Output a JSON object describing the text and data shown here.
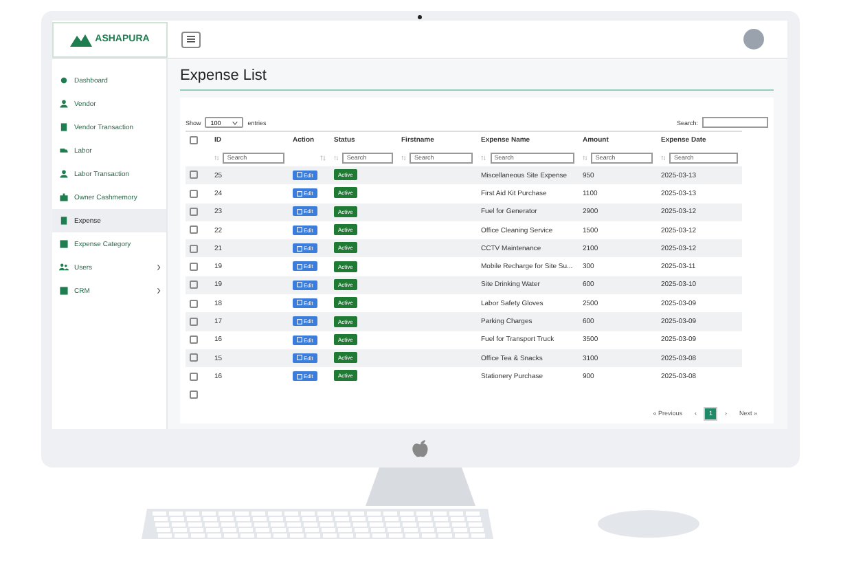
{
  "logo": {
    "text": "ASHAPURA"
  },
  "sidebar": {
    "items": [
      {
        "label": "Dashboard",
        "selected": false,
        "expandable": false
      },
      {
        "label": "Vendor",
        "selected": false,
        "expandable": false
      },
      {
        "label": "Vendor Transaction",
        "selected": false,
        "expandable": false
      },
      {
        "label": "Labor",
        "selected": false,
        "expandable": false
      },
      {
        "label": "Labor Transaction",
        "selected": false,
        "expandable": false
      },
      {
        "label": "Owner Cashmemory",
        "selected": false,
        "expandable": false
      },
      {
        "label": "Expense",
        "selected": true,
        "expandable": false
      },
      {
        "label": "Expense Category",
        "selected": false,
        "expandable": false
      },
      {
        "label": "Users",
        "selected": false,
        "expandable": true
      },
      {
        "label": "CRM",
        "selected": false,
        "expandable": true
      }
    ]
  },
  "page_title": "Expense List",
  "length_control": {
    "before": "Show",
    "value": "100",
    "after": "entries"
  },
  "search": {
    "label": "Search:"
  },
  "table": {
    "select_all": {
      "selected": false
    },
    "columns": [
      {
        "label": "ID",
        "placeholder": "Search"
      },
      {
        "label": "Action"
      },
      {
        "label": "Status",
        "placeholder": "Search"
      },
      {
        "label": "Firstname",
        "placeholder": "Search"
      },
      {
        "label": "Expense Name",
        "placeholder": "Search"
      },
      {
        "label": "Amount",
        "placeholder": "Search"
      },
      {
        "label": "Expense Date",
        "placeholder": "Search"
      }
    ],
    "rows": [
      {
        "selected": false,
        "id": "25",
        "action": "Edit",
        "status": "Active",
        "name": "Miscellaneous Site Expense",
        "amount": "950",
        "date": "2025-03-13"
      },
      {
        "selected": false,
        "id": "24",
        "action": "Edit",
        "status": "Active",
        "name": "First Aid Kit Purchase",
        "amount": "1100",
        "date": "2025-03-13"
      },
      {
        "selected": false,
        "id": "23",
        "action": "Edit",
        "status": "Active",
        "name": "Fuel for Generator",
        "amount": "2900",
        "date": "2025-03-12"
      },
      {
        "selected": false,
        "id": "22",
        "action": "Edit",
        "status": "Active",
        "name": "Office Cleaning Service",
        "amount": "1500",
        "date": "2025-03-12"
      },
      {
        "selected": false,
        "id": "21",
        "action": "Edit",
        "status": "Active",
        "name": "CCTV Maintenance",
        "amount": "2100",
        "date": "2025-03-12"
      },
      {
        "selected": false,
        "id": "19",
        "action": "Edit",
        "status": "Active",
        "name": "Mobile Recharge for Site Su...",
        "amount": "300",
        "date": "2025-03-11"
      },
      {
        "selected": false,
        "id": "19",
        "action": "Edit",
        "status": "Active",
        "name": "Site Drinking Water",
        "amount": "600",
        "date": "2025-03-10"
      },
      {
        "selected": false,
        "id": "18",
        "action": "Edit",
        "status": "Active",
        "name": "Labor Safety Gloves",
        "amount": "2500",
        "date": "2025-03-09"
      },
      {
        "selected": false,
        "id": "17",
        "action": "Edit",
        "status": "Active",
        "name": "Parking Charges",
        "amount": "600",
        "date": "2025-03-09"
      },
      {
        "selected": false,
        "id": "16",
        "action": "Edit",
        "status": "Active",
        "name": "Fuel for Transport Truck",
        "amount": "3500",
        "date": "2025-03-09"
      },
      {
        "selected": false,
        "id": "15",
        "action": "Edit",
        "status": "Active",
        "name": "Office Tea & Snacks",
        "amount": "3100",
        "date": "2025-03-08"
      },
      {
        "selected": false,
        "id": "16",
        "action": "Edit",
        "status": "Active",
        "name": "Stationery Purchase",
        "amount": "900",
        "date": "2025-03-08"
      }
    ],
    "footer_checkbox": {
      "selected": false
    }
  },
  "pagination": {
    "previous": "« Previous",
    "prev_arrow": "‹",
    "pages": [
      {
        "label": "1",
        "selected": true
      }
    ],
    "next_arrow": "›",
    "next": "Next »"
  }
}
